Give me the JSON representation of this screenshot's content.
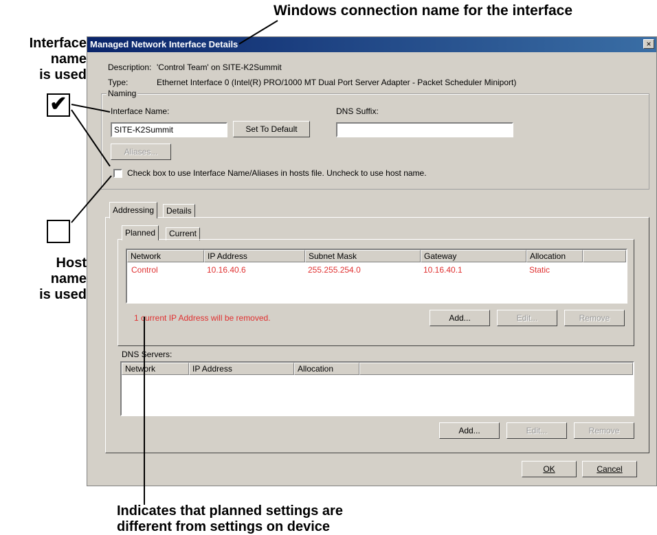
{
  "callouts": {
    "top": "Windows connection name for the interface",
    "iface_line1": "Interface",
    "iface_line2": "name",
    "iface_line3": "is used",
    "host_line1": "Host",
    "host_line2": "name",
    "host_line3": "is used",
    "bottom_line1": "Indicates that planned settings are",
    "bottom_line2": "different from settings on device",
    "checked_symbol": "✔"
  },
  "dialog": {
    "title": "Managed Network Interface Details",
    "close_symbol": "×",
    "description_label": "Description:",
    "description_value": "'Control Team' on SITE-K2Summit",
    "type_label": "Type:",
    "type_value": "Ethernet Interface 0 (Intel(R) PRO/1000 MT Dual Port Server Adapter - Packet Scheduler Miniport)"
  },
  "naming": {
    "group_label": "Naming",
    "interface_name_label": "Interface Name:",
    "interface_name_value": "SITE-K2Summit",
    "set_default_button": "Set To Default",
    "dns_suffix_label": "DNS Suffix:",
    "dns_suffix_value": "",
    "aliases_button": "Aliases...",
    "hosts_checkbox_label": "Check box to use Interface Name/Aliases in hosts file. Uncheck to use host name.",
    "hosts_checkbox_checked": false
  },
  "tabs": {
    "addressing": "Addressing",
    "details": "Details",
    "active": "Addressing"
  },
  "subtabs": {
    "planned": "Planned",
    "current": "Current",
    "active": "Planned"
  },
  "ip_table": {
    "columns": [
      "Network",
      "IP Address",
      "Subnet Mask",
      "Gateway",
      "Allocation"
    ],
    "rows": [
      {
        "network": "Control",
        "ip": "10.16.40.6",
        "mask": "255.255.254.0",
        "gateway": "10.16.40.1",
        "allocation": "Static"
      }
    ],
    "warning": "1 current IP Address will be removed.",
    "add_button": "Add...",
    "edit_button": "Edit...",
    "remove_button": "Remove"
  },
  "dns": {
    "label": "DNS Servers:",
    "columns": [
      "Network",
      "IP Address",
      "Allocation"
    ],
    "rows": [],
    "add_button": "Add...",
    "edit_button": "Edit...",
    "remove_button": "Remove"
  },
  "footer": {
    "ok_button": "OK",
    "cancel_button": "Cancel"
  },
  "colors": {
    "window_bg": "#d4d0c8",
    "titlebar_start": "#0a246a",
    "titlebar_end": "#3a6ea5",
    "changed_text": "#e03030"
  }
}
